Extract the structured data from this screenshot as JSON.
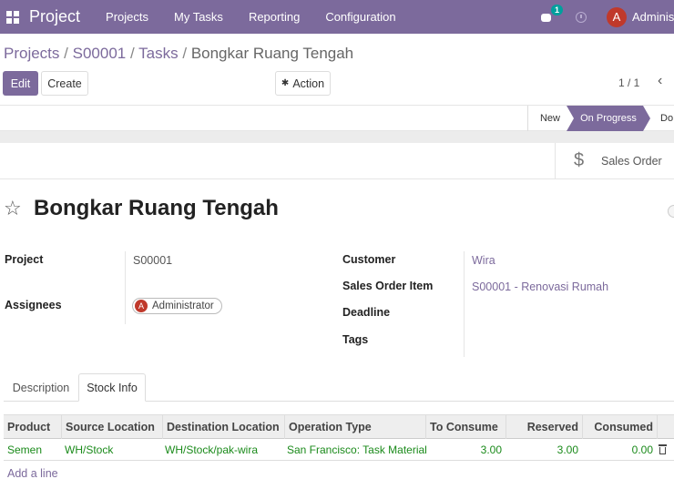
{
  "navbar": {
    "app_title": "Project",
    "menu": [
      "Projects",
      "My Tasks",
      "Reporting",
      "Configuration"
    ],
    "message_count": "1",
    "avatar_letter": "A",
    "user_name": "Adminis"
  },
  "breadcrumb": {
    "items": [
      "Projects",
      "S00001",
      "Tasks"
    ],
    "current": "Bongkar Ruang Tengah",
    "separator": "/"
  },
  "controls": {
    "edit_label": "Edit",
    "create_label": "Create",
    "action_label": "Action",
    "pager": "1 / 1",
    "prev_glyph": "‹"
  },
  "stages": {
    "new": "New",
    "on_progress": "On Progress",
    "done": "Do",
    "active": "On Progress"
  },
  "smart_buttons": {
    "sales_order": "Sales Order"
  },
  "task": {
    "title": "Bongkar Ruang Tengah",
    "project_label": "Project",
    "project_value": "S00001",
    "assignees_label": "Assignees",
    "assignee_letter": "A",
    "assignee_name": "Administrator",
    "customer_label": "Customer",
    "customer_value": "Wira",
    "sales_order_item_label": "Sales Order Item",
    "sales_order_item_value": "S00001 - Renovasi Rumah",
    "deadline_label": "Deadline",
    "deadline_value": "",
    "tags_label": "Tags",
    "tags_value": ""
  },
  "tabs": {
    "description": "Description",
    "stock_info": "Stock Info",
    "active": "Stock Info"
  },
  "stock_table": {
    "headers": {
      "product": "Product",
      "source": "Source Location",
      "destination": "Destination Location",
      "operation_type": "Operation Type",
      "to_consume": "To Consume",
      "reserved": "Reserved",
      "consumed": "Consumed"
    },
    "rows": [
      {
        "product": "Semen",
        "source": "WH/Stock",
        "destination": "WH/Stock/pak-wira",
        "operation_type": "San Francisco: Task Material",
        "to_consume": "3.00",
        "reserved": "3.00",
        "consumed": "0.00"
      }
    ],
    "add_line_label": "Add a line"
  },
  "colors": {
    "brand": "#7c6a9c",
    "avatar": "#c0392b",
    "badge": "#00a09d",
    "row_text": "#1a8a1a"
  },
  "icons": [
    "apps-grid-icon",
    "chat-icon",
    "clock-icon",
    "gear-icon",
    "dollar-icon",
    "star-icon",
    "trash-icon",
    "chevron-left-icon"
  ]
}
